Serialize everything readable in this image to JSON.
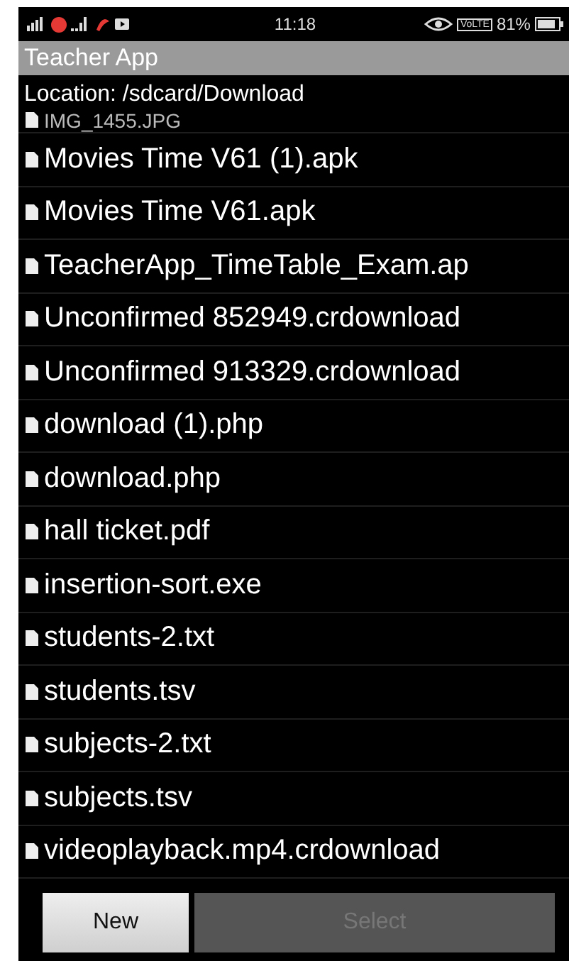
{
  "status_bar": {
    "time": "11:18",
    "volte": "VoLTE",
    "battery_text": "81%"
  },
  "app_bar": {
    "title": "Teacher App"
  },
  "location": "Location: /sdcard/Download",
  "files": [
    {
      "name": "IMG_1455.JPG"
    },
    {
      "name": "Movies Time V61 (1).apk"
    },
    {
      "name": "Movies Time V61.apk"
    },
    {
      "name": "TeacherApp_TimeTable_Exam.ap"
    },
    {
      "name": "Unconfirmed 852949.crdownload"
    },
    {
      "name": "Unconfirmed 913329.crdownload"
    },
    {
      "name": "download (1).php"
    },
    {
      "name": "download.php"
    },
    {
      "name": "hall ticket.pdf"
    },
    {
      "name": "insertion-sort.exe"
    },
    {
      "name": "students-2.txt"
    },
    {
      "name": "students.tsv"
    },
    {
      "name": "subjects-2.txt"
    },
    {
      "name": "subjects.tsv"
    },
    {
      "name": "videoplayback.mp4.crdownload"
    }
  ],
  "buttons": [
    {
      "label": "New",
      "disabled": false
    },
    {
      "label": "Select",
      "disabled": true
    }
  ]
}
